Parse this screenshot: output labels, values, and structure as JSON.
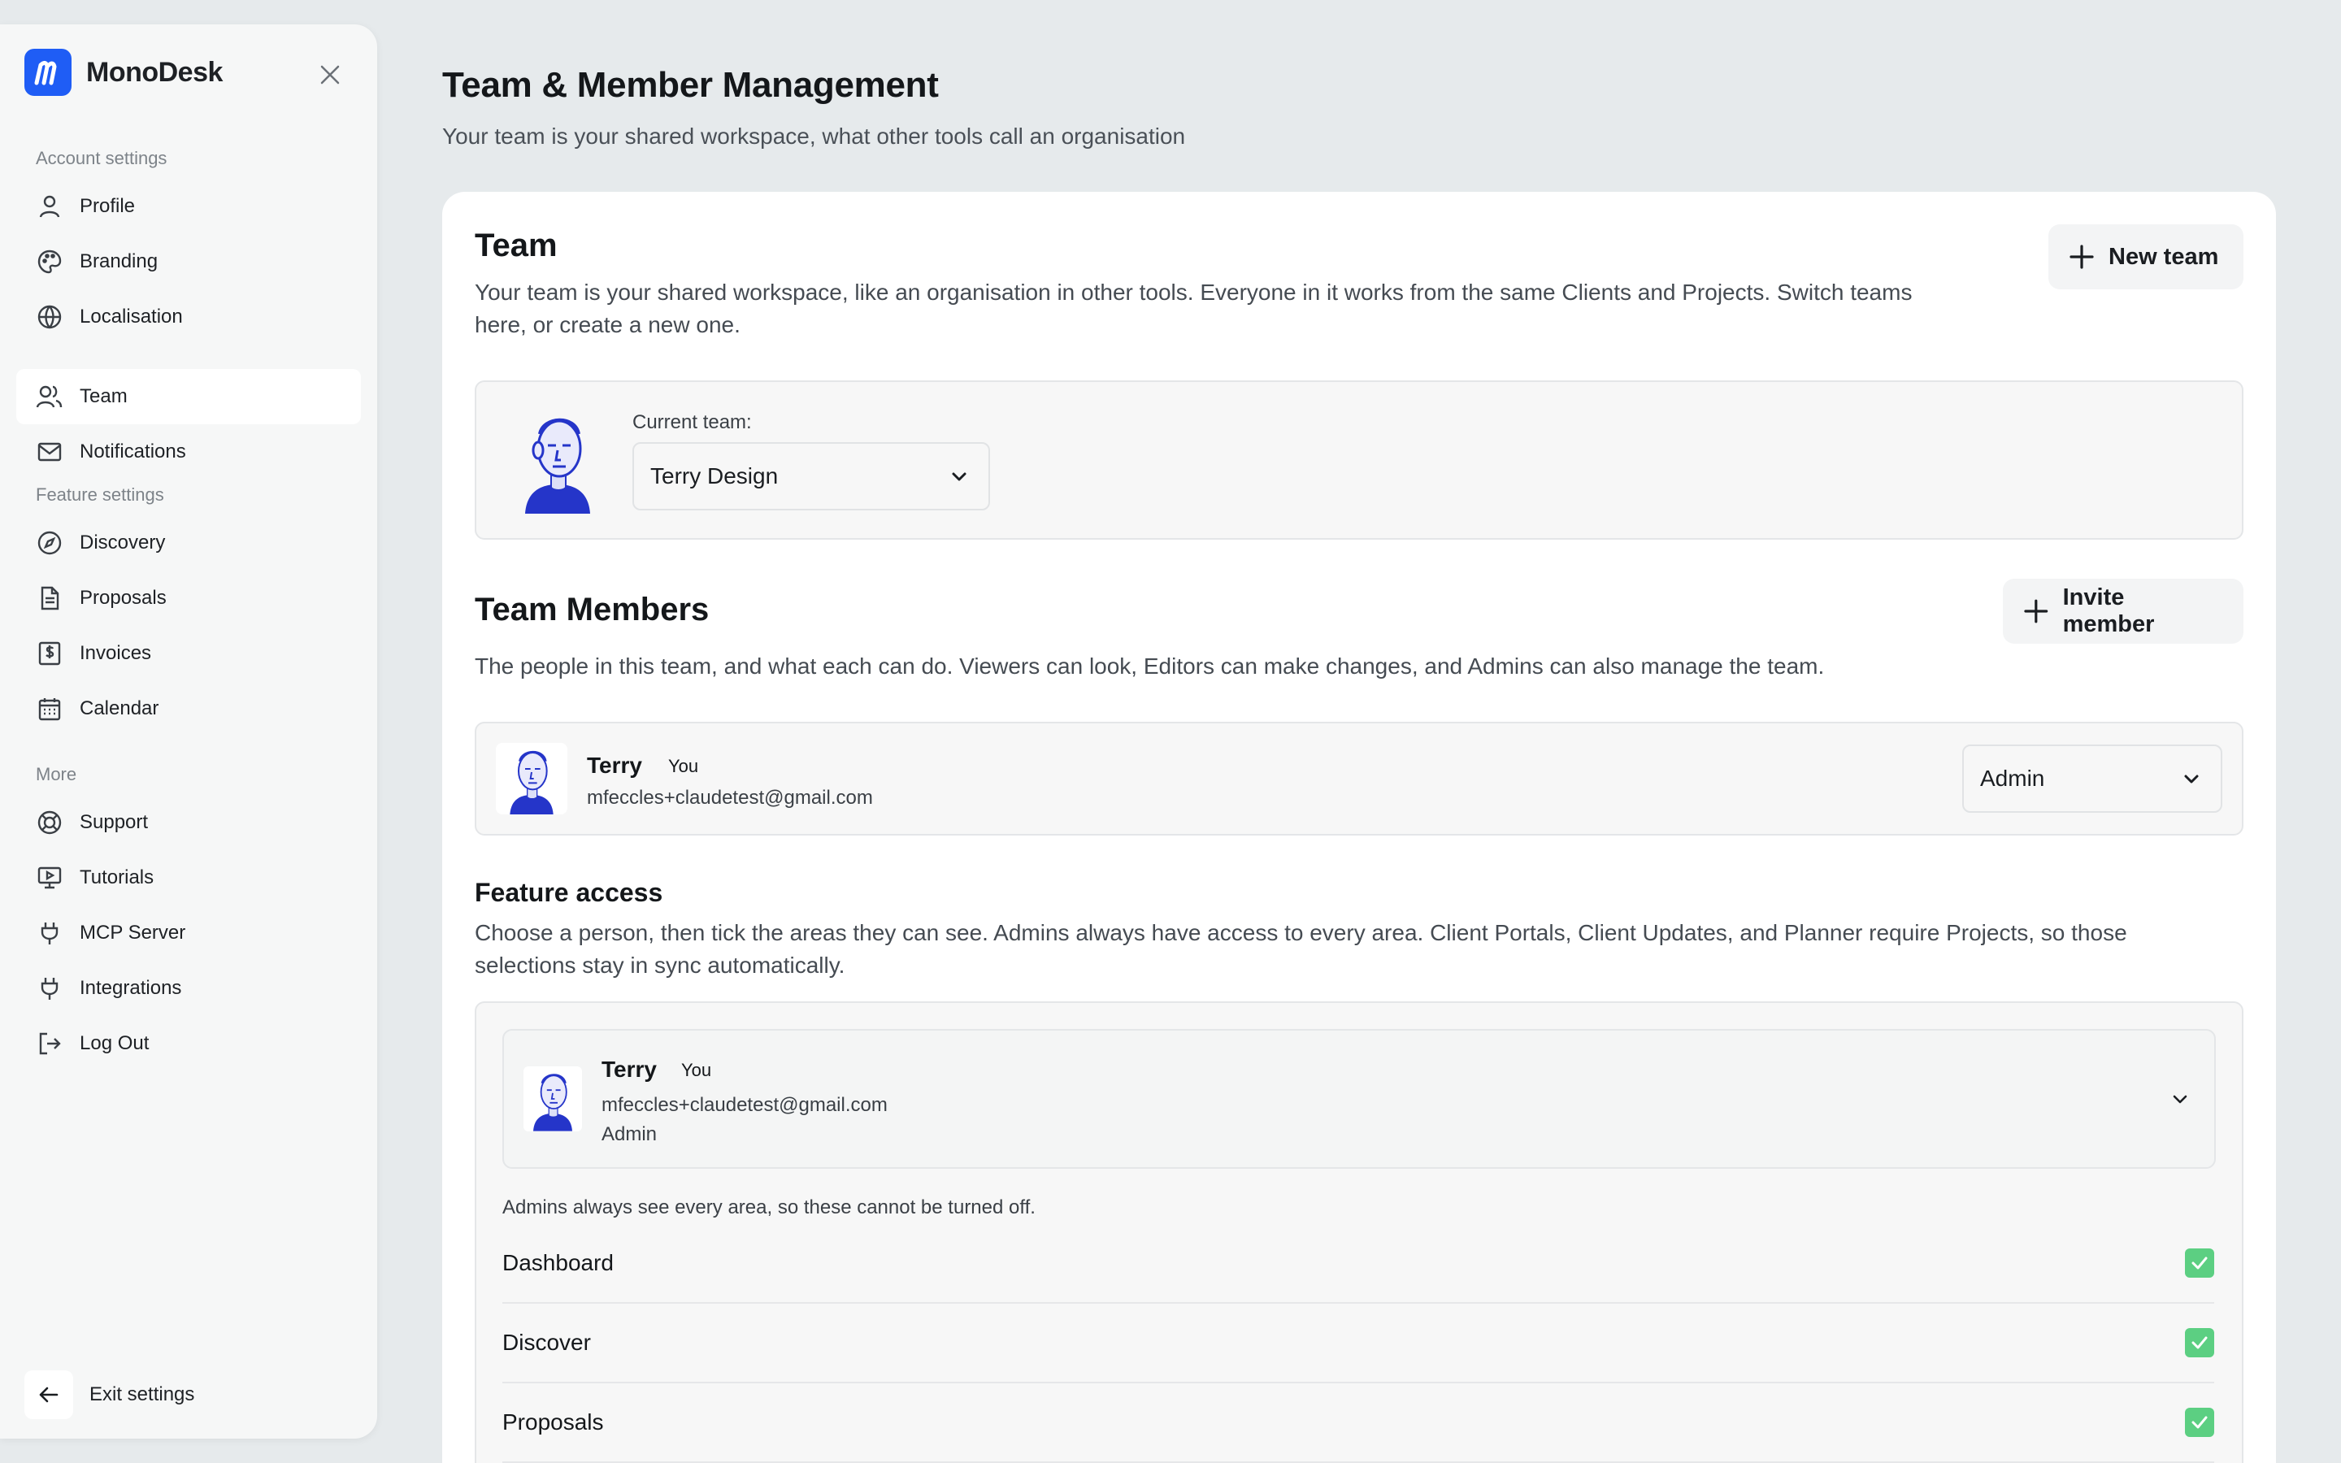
{
  "brand": {
    "name": "MonoDesk",
    "color": "#1f5df5"
  },
  "sidebar": {
    "sections": [
      {
        "label": "Account settings"
      },
      {
        "label": "Feature settings"
      },
      {
        "label": "More"
      }
    ],
    "items": [
      {
        "label": "Profile",
        "icon": "user-icon"
      },
      {
        "label": "Branding",
        "icon": "palette-icon"
      },
      {
        "label": "Localisation",
        "icon": "globe-icon"
      },
      {
        "label": "Team",
        "icon": "users-icon",
        "active": true
      },
      {
        "label": "Notifications",
        "icon": "mail-icon"
      },
      {
        "label": "Discovery",
        "icon": "compass-icon"
      },
      {
        "label": "Proposals",
        "icon": "document-icon"
      },
      {
        "label": "Invoices",
        "icon": "invoice-icon"
      },
      {
        "label": "Calendar",
        "icon": "calendar-icon"
      },
      {
        "label": "Support",
        "icon": "lifebuoy-icon"
      },
      {
        "label": "Tutorials",
        "icon": "video-icon"
      },
      {
        "label": "MCP Server",
        "icon": "plug-icon"
      },
      {
        "label": "Integrations",
        "icon": "plug-icon"
      },
      {
        "label": "Log Out",
        "icon": "logout-icon"
      }
    ],
    "exit_label": "Exit settings"
  },
  "page": {
    "title": "Team & Member Management",
    "subtitle": "Your team is your shared workspace, what other tools call an organisation"
  },
  "team": {
    "heading": "Team",
    "description_line1": "Your team is your shared workspace, like an organisation in other tools. Everyone in it works from the same Clients and Projects. Switch teams",
    "description_line2": "here, or create a new one.",
    "new_team_label": "New team",
    "current_team_label": "Current team:",
    "current_team_value": "Terry Design"
  },
  "members": {
    "heading": "Team Members",
    "description": "The people in this team, and what each can do. Viewers can look, Editors can make changes, and Admins can also manage the team.",
    "invite_label": "Invite member",
    "list": [
      {
        "name": "Terry",
        "tag": "You",
        "email": "mfeccles+claudetest@gmail.com",
        "role": "Admin"
      }
    ]
  },
  "feature_access": {
    "heading": "Feature access",
    "description_line1": "Choose a person, then tick the areas they can see. Admins always have access to every area. Client Portals, Client Updates, and Planner require Projects, so those",
    "description_line2": "selections stay in sync automatically.",
    "selected": {
      "name": "Terry",
      "tag": "You",
      "email": "mfeccles+claudetest@gmail.com",
      "role": "Admin"
    },
    "admin_note": "Admins always see every area, so these cannot be turned off.",
    "features": [
      {
        "label": "Dashboard",
        "checked": true
      },
      {
        "label": "Discover",
        "checked": true
      },
      {
        "label": "Proposals",
        "checked": true
      }
    ],
    "check_color": "#5ccf82"
  }
}
